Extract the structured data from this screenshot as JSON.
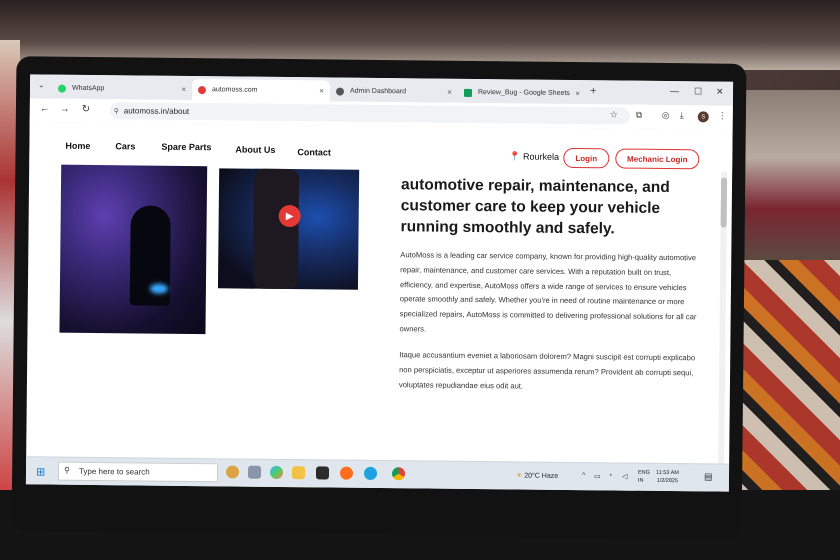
{
  "browser": {
    "tabs": [
      {
        "title": "WhatsApp",
        "favicon_color": "#25d366"
      },
      {
        "title": "automoss.com",
        "favicon_color": "#e53935"
      },
      {
        "title": "Admin Dashboard",
        "favicon_color": "#555555"
      },
      {
        "title": "Review_Bug - Google Sheets",
        "favicon_color": "#0f9d58"
      }
    ],
    "url": "automoss.in/about",
    "profile_initial": "S"
  },
  "nav": {
    "links": [
      "Home",
      "Cars",
      "Spare Parts",
      "About Us",
      "Contact"
    ],
    "location": "Rourkela",
    "login": "Login",
    "mechanic_login": "Mechanic Login"
  },
  "content": {
    "headline": "automotive repair, maintenance, and customer care to keep your vehicle running smoothly and safely.",
    "paragraph1": "AutoMoss is a leading car service company, known for providing high-quality automotive repair, maintenance, and customer care services. With a reputation built on trust, efficiency, and expertise, AutoMoss offers a wide range of services to ensure vehicles operate smoothly and safely. Whether you're in need of routine maintenance or more specialized repairs, AutoMoss is committed to delivering professional solutions for all car owners.",
    "paragraph2": "Itaque accusantium eveniet a laboriosam dolorem? Magni suscipit est corrupti explicabo non perspiciatis, exceptur ut asperiores assumenda rerum? Provident ab corrupti sequi, voluptates repudiandae eius odit aut."
  },
  "taskbar": {
    "search_placeholder": "Type here to search",
    "weather": "20°C  Haze",
    "lang_line1": "ENG",
    "lang_line2": "IN",
    "time": "11:53 AM",
    "date": "1/2/2025"
  },
  "colors": {
    "accent": "#c62828",
    "play": "#e53935"
  }
}
